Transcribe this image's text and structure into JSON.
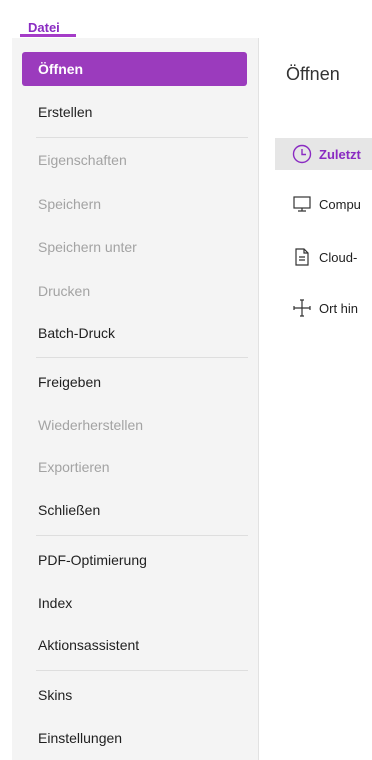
{
  "header": {
    "file_tab": "Datei"
  },
  "colors": {
    "accent": "#9b3bbd",
    "accent_text": "#8a2bc2",
    "disabled": "#a3a3a3"
  },
  "sidebar": {
    "items": [
      {
        "label": "Öffnen",
        "state": "active"
      },
      {
        "label": "Erstellen",
        "state": "enabled"
      },
      {
        "label": "Eigenschaften",
        "state": "disabled"
      },
      {
        "label": "Speichern",
        "state": "disabled"
      },
      {
        "label": "Speichern unter",
        "state": "disabled"
      },
      {
        "label": "Drucken",
        "state": "disabled"
      },
      {
        "label": "Batch-Druck",
        "state": "enabled"
      },
      {
        "label": "Freigeben",
        "state": "enabled"
      },
      {
        "label": "Wiederherstellen",
        "state": "disabled"
      },
      {
        "label": "Exportieren",
        "state": "disabled"
      },
      {
        "label": "Schließen",
        "state": "enabled"
      },
      {
        "label": "PDF-Optimierung",
        "state": "enabled"
      },
      {
        "label": "Index",
        "state": "enabled"
      },
      {
        "label": "Aktionsassistent",
        "state": "enabled"
      },
      {
        "label": "Skins",
        "state": "enabled"
      },
      {
        "label": "Einstellungen",
        "state": "enabled"
      }
    ]
  },
  "main": {
    "title": "Öffnen",
    "locations": [
      {
        "label": "Zuletzt",
        "icon": "clock-icon",
        "selected": true
      },
      {
        "label": "Compu",
        "icon": "monitor-icon",
        "selected": false
      },
      {
        "label": "Cloud-",
        "icon": "document-icon",
        "selected": false
      },
      {
        "label": "Ort hin",
        "icon": "plus-icon",
        "selected": false
      }
    ]
  }
}
